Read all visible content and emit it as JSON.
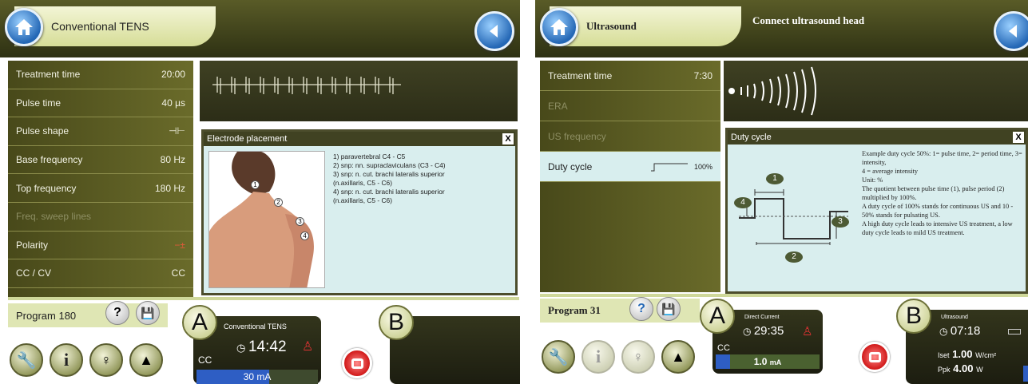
{
  "left": {
    "header_title": "Conventional TENS",
    "params": [
      {
        "label": "Treatment time",
        "value": "20:00",
        "state": "normal"
      },
      {
        "label": "Pulse time",
        "value": "40 µs",
        "state": "normal"
      },
      {
        "label": "Pulse shape",
        "value": "⊣⊢",
        "state": "normal"
      },
      {
        "label": "Base frequency",
        "value": "80 Hz",
        "state": "normal"
      },
      {
        "label": "Top frequency",
        "value": "180 Hz",
        "state": "normal"
      },
      {
        "label": "Freq. sweep lines",
        "value": "",
        "state": "dim"
      },
      {
        "label": "Polarity",
        "value": "−±",
        "state": "normal"
      },
      {
        "label": "CC / CV",
        "value": "CC",
        "state": "normal"
      }
    ],
    "panel_title": "Electrode placement",
    "panel_text": [
      "1) paravertebral C4 - C5",
      "2) snp: nn. supraclaviculans (C3 - C4)",
      "3) snp: n. cut. brachi lateralis superior (n.axillaris, C5 - C6)",
      "4) snp: n. cut. brachi lateralis superior (n.axillaris, C5 - C6)"
    ],
    "markers": [
      "1",
      "2",
      "3",
      "4"
    ],
    "program": "Program 180",
    "channel_a": {
      "letter": "A",
      "name": "Conventional TENS",
      "time": "14:42",
      "mode": "CC",
      "current": "30 mA",
      "fill_pct": 60
    },
    "channel_b": {
      "letter": "B"
    }
  },
  "right": {
    "header_title": "Ultrasound",
    "header_instruction": "Connect ultrasound head",
    "params": [
      {
        "label": "Treatment time",
        "value": "7:30",
        "state": "normal"
      },
      {
        "label": "ERA",
        "value": "",
        "state": "dim"
      },
      {
        "label": "US frequency",
        "value": "",
        "state": "dim"
      },
      {
        "label": "Duty cycle",
        "value": "100%",
        "state": "selected"
      }
    ],
    "panel_title": "Duty cycle",
    "panel_text": [
      "Example duty cycle 50%: 1= pulse time, 2= period time, 3= intensity,",
      "4 = average intensity",
      "Unit: %",
      "The quotient between pulse time (1), pulse period (2) multiplied by 100%.",
      "A duty cycle of 100% stands for continuous US and 10 - 50% stands for pulsating US.",
      "A high duty cycle leads to intensive US treatment, a low duty cycle leads to mild US treatment."
    ],
    "diagram_labels": [
      "1",
      "2",
      "3",
      "4"
    ],
    "program": "Program 31",
    "channel_a": {
      "letter": "A",
      "name": "Direct Current",
      "time": "29:35",
      "mode": "CC",
      "current": "1.0",
      "unit": "mA",
      "fill_pct": 14
    },
    "channel_b": {
      "letter": "B",
      "name": "Ultrasound",
      "time": "07:18",
      "iset_label": "Iset",
      "iset_value": "1.00",
      "iset_unit": "W/cm²",
      "ppk_label": "Ppk",
      "ppk_value": "4.00",
      "ppk_unit": "W"
    }
  },
  "colors": {
    "header": "#3a3c1a",
    "panel_bg": "#d9eeee",
    "accent_blue": "#2467b5",
    "stop_red": "#d11919",
    "bar_blue": "#2e5ec4"
  }
}
